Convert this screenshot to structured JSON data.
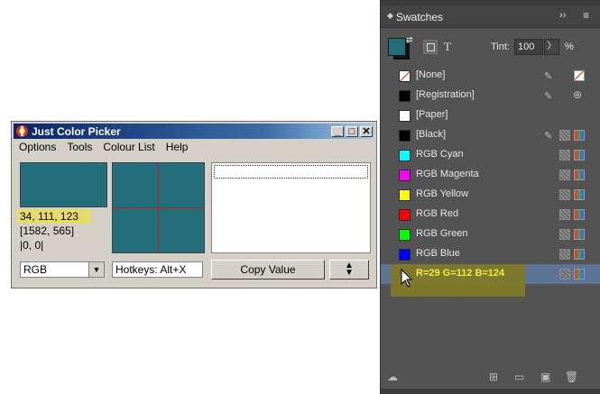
{
  "colors": {
    "picked": "#226f7b",
    "panel_bg": "#535353",
    "selected_row": "#5e7596",
    "highlight": "#e6dc6b"
  },
  "picker": {
    "title": "Just Color Picker",
    "menu": [
      "Options",
      "Tools",
      "Colour List",
      "Help"
    ],
    "rgb_text": "34, 111, 123",
    "position_text": "[1582, 565]",
    "offset_text": "|0, 0|",
    "format_value": "RGB",
    "hotkeys_text": "Hotkeys: Alt+X",
    "copy_label": "Copy Value"
  },
  "swatches": {
    "title": "Swatches",
    "tint_label": "Tint:",
    "tint_value": "100",
    "tint_unit": "%",
    "items": [
      {
        "label": "[None]",
        "color": "none"
      },
      {
        "label": "[Registration]",
        "color": "#000000"
      },
      {
        "label": "[Paper]",
        "color": "#ffffff"
      },
      {
        "label": "[Black]",
        "color": "#000000"
      },
      {
        "label": "RGB Cyan",
        "color": "#00ffff"
      },
      {
        "label": "RGB Magenta",
        "color": "#ff00ff"
      },
      {
        "label": "RGB Yellow",
        "color": "#ffff00"
      },
      {
        "label": "RGB Red",
        "color": "#ff0000"
      },
      {
        "label": "RGB Green",
        "color": "#00ff00"
      },
      {
        "label": "RGB Blue",
        "color": "#0000ff"
      },
      {
        "label": "",
        "color": "#1d7070"
      }
    ],
    "tooltip": "R=29 G=112 B=124"
  }
}
